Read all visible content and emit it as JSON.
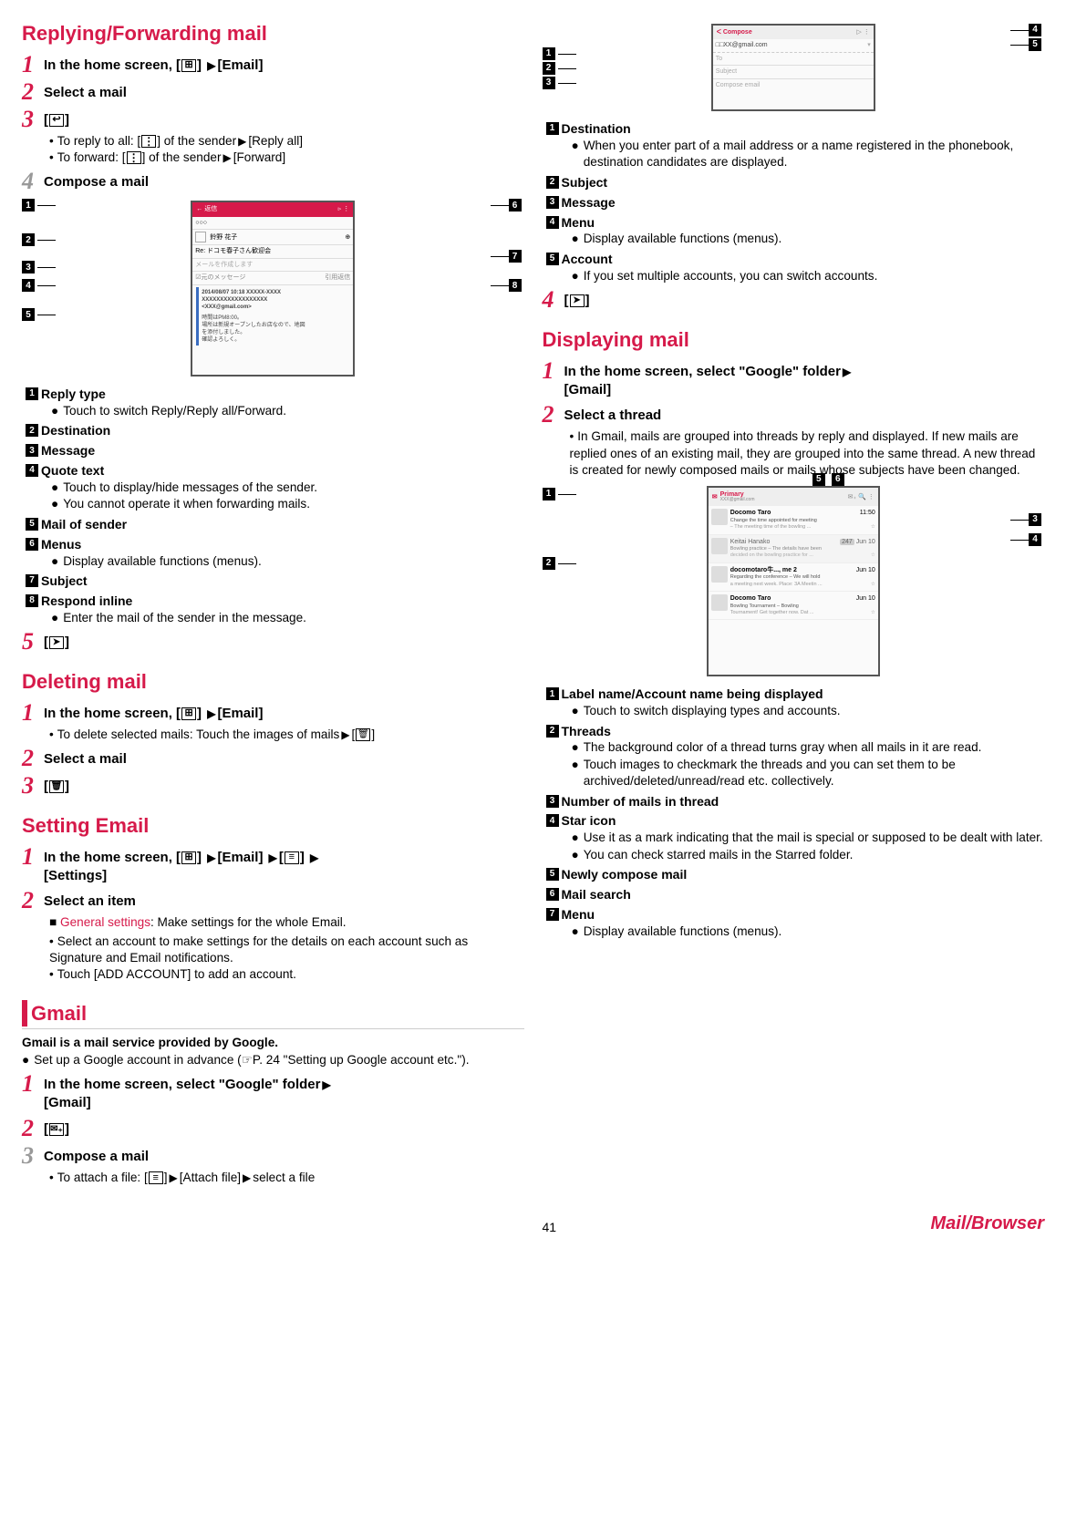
{
  "leftCol": {
    "h_reply": "Replying/Forwarding mail",
    "s1": {
      "n": "1",
      "t": "In the home screen, [",
      "t2": "]",
      "t3": "[Email]"
    },
    "s2": {
      "n": "2",
      "t": "Select a mail"
    },
    "s3": {
      "n": "3",
      "t": "[",
      "icon": "↩",
      "t2": "]"
    },
    "s3_b1": "To reply to all: [",
    "s3_b1b": "] of the sender",
    "s3_b1c": "[Reply all]",
    "s3_b2": "To forward: [",
    "s3_b2b": "] of the sender",
    "s3_b2c": "[Forward]",
    "s4": {
      "n": "4",
      "t": "Compose a mail"
    },
    "fig1": {
      "head_left": "←  返信",
      "head_right": "▹    ⋮",
      "to_label": "○○○",
      "name": "鈴野 花子",
      "subj": "Re: ドコモ春子さん歓迎会",
      "body_ph": "メールを作成します",
      "quote_btn": "元のメッセージ",
      "inline_btn": "引用返信",
      "meta1": "2014/08/07 10:18 XXXXX-XXXX",
      "meta2": "XXXXXXXXXXXXXXXXXX",
      "meta3": "<XXX@gmail.com>",
      "quote1": "時間はPM8:00。",
      "quote2": "場所は新規オープンしたお店なので、地図",
      "quote3": "を添付しました。",
      "quote4": "確認よろしく。"
    },
    "leg1": {
      "l1_t": "Reply type",
      "l1_d": "Touch to switch Reply/Reply all/Forward.",
      "l2_t": "Destination",
      "l3_t": "Message",
      "l4_t": "Quote text",
      "l4_d1": "Touch to display/hide messages of the sender.",
      "l4_d2": "You cannot operate it when forwarding mails.",
      "l5_t": "Mail of sender",
      "l6_t": "Menus",
      "l6_d": "Display available functions (menus).",
      "l7_t": "Subject",
      "l8_t": "Respond inline",
      "l8_d": "Enter the mail of the sender in the message."
    },
    "s5": {
      "n": "5",
      "t": "[",
      "t2": "]"
    },
    "h_delete": "Deleting mail",
    "d1": {
      "n": "1",
      "t": "In the home screen, [",
      "t2": "]",
      "t3": "[Email]"
    },
    "d1_b": "To delete selected mails: Touch the images of mails",
    "d1_c": "[",
    "d1_d": "]",
    "d2": {
      "n": "2",
      "t": "Select a mail"
    },
    "d3": {
      "n": "3",
      "t": "[",
      "t2": "]"
    },
    "h_setting": "Setting Email",
    "e1": {
      "n": "1",
      "t1": "In the home screen, [",
      "t2": "]",
      "t3": "[Email]",
      "t4": "[",
      "t5": "]",
      "t6": "[Settings]"
    },
    "e2": {
      "n": "2",
      "t": "Select an item"
    },
    "e2_r": "General settings",
    "e2_rt": ": Make settings for the whole Email.",
    "e2_b1": "Select an account to make settings for the details on each account such as Signature and Email notifications.",
    "e2_b2": "Touch [ADD ACCOUNT] to add an account.",
    "h_gmail": "Gmail",
    "g_intro": "Gmail is a mail service provided by Google.",
    "g_setup1": "Set up a Google account in advance (",
    "g_setup2": "P. 24 \"Setting up Google account etc.\").",
    "g1": {
      "n": "1",
      "t1": "In the home screen, select \"Google\" folder",
      "t2": "[Gmail]"
    },
    "g2": {
      "n": "2",
      "t": "[",
      "t2": "]"
    },
    "g3": {
      "n": "3",
      "t": "Compose a mail"
    },
    "g3_b": "To attach a file: [",
    "g3_b2": "]",
    "g3_b3": "[Attach file]",
    "g3_b4": "select a file"
  },
  "rightCol": {
    "fig2": {
      "head": "Compose",
      "from": "□□XX@gmail.com",
      "to_ph": "To",
      "subj_ph": "Subject",
      "body_ph": "Compose email"
    },
    "leg2": {
      "l1_t": "Destination",
      "l1_d": "When you enter part of a mail address or a name registered in the phonebook, destination candidates are displayed.",
      "l2_t": "Subject",
      "l3_t": "Message",
      "l4_t": "Menu",
      "l4_d": "Display available functions (menus).",
      "l5_t": "Account",
      "l5_d": "If you set multiple accounts, you can switch accounts."
    },
    "s4g": {
      "n": "4",
      "t": "[",
      "t2": "]"
    },
    "h_disp": "Displaying mail",
    "d1g": {
      "n": "1",
      "t1": "In the home screen, select \"Google\" folder",
      "t2": "[Gmail]"
    },
    "d2g": {
      "n": "2",
      "t": "Select a thread"
    },
    "d2g_b": "In Gmail, mails are grouped into threads by reply and displayed. If new mails are replied ones of an existing mail, they are grouped into the same thread. A new thread is created for newly composed mails or mails whose subjects have been changed.",
    "fig3": {
      "label": "Primary",
      "acct": "XXX@gmail.com",
      "r1_name": "Docomo Taro",
      "r1_time": "11:50",
      "r1_sub": "Change the time appointed for meeting",
      "r1_prev": "– The meeting time of the bowling ...",
      "r2_name": "Keitai Hanako",
      "r2_badge": "247",
      "r2_time": "Jun 10",
      "r2_sub": "Bowling practice – The details have been",
      "r2_prev": "decided on the bowling practice for ...",
      "r3_name": "docomotaro牛..., me 2",
      "r3_time": "Jun 10",
      "r3_sub": "Regarding the conference – We will hold",
      "r3_prev": "a meeting next week. Place: 3A Meetin ...",
      "r4_name": "Docomo Taro",
      "r4_time": "Jun 10",
      "r4_sub": "Bowling Tournament – Bowling",
      "r4_prev": "Tournament! Get together now. Dat ..."
    },
    "leg3": {
      "l1_t": "Label name/Account name being displayed",
      "l1_d": "Touch to switch displaying types and accounts.",
      "l2_t": "Threads",
      "l2_d1": "The background color of a thread turns gray when all mails in it are read.",
      "l2_d2": "Touch images to checkmark the threads and you can set them to be archived/deleted/unread/read etc. collectively.",
      "l3_t": "Number of mails in thread",
      "l4_t": "Star icon",
      "l4_d1": "Use it as a mark indicating that the mail is special or supposed to be dealt with later.",
      "l4_d2": "You can check starred mails in the Starred folder.",
      "l5_t": "Newly compose mail",
      "l6_t": "Mail search",
      "l7_t": "Menu",
      "l7_d": "Display available functions (menus)."
    }
  },
  "footer": {
    "page": "41",
    "link": "Mail/Browser"
  }
}
